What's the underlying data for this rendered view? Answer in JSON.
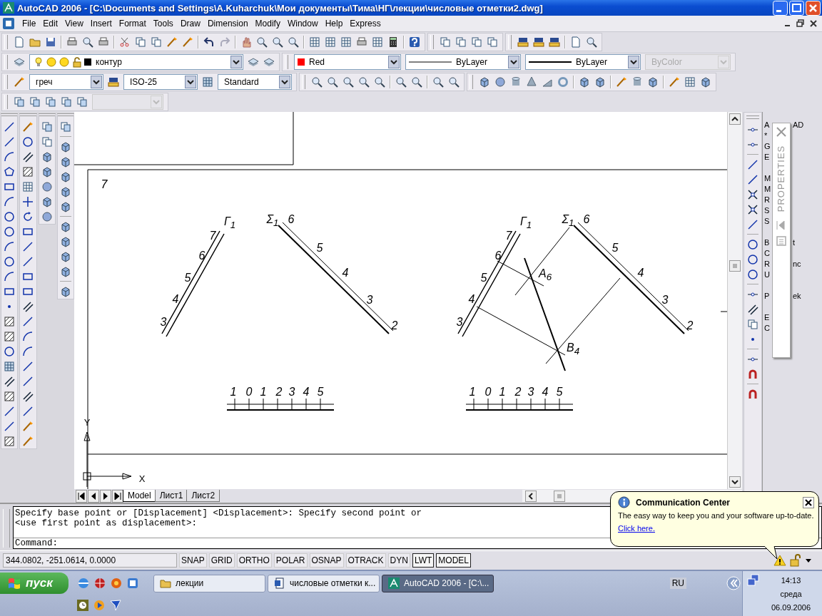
{
  "window": {
    "title": "AutoCAD 2006 - [C:\\Documents and Settings\\A.Kuharchuk\\Мои документы\\Тима\\НГ\\лекции\\числовые отметки2.dwg]"
  },
  "menu": [
    "File",
    "Edit",
    "View",
    "Insert",
    "Format",
    "Tools",
    "Draw",
    "Dimension",
    "Modify",
    "Window",
    "Help",
    "Express"
  ],
  "layer_bar": {
    "layer": {
      "name": "контур"
    },
    "color": {
      "label": "Red"
    },
    "linetype": "ByLayer",
    "lineweight": "ByLayer",
    "plot_style": {
      "value": "ByColor",
      "disabled": true
    }
  },
  "style_bar": {
    "text_style": "греч",
    "dim_style": "ISO-25",
    "table_style": "Standard"
  },
  "view_bar": {
    "dropdown": {
      "disabled": true
    }
  },
  "drawing": {
    "sheet_number": "7",
    "axis_labels": {
      "y": "Y",
      "x": "X"
    },
    "views": [
      {
        "trace_label": "Г$_{1}$",
        "trace_marks": [
          "3",
          "4",
          "5",
          "6",
          "7"
        ],
        "plane_label": "Σ$_{1}$",
        "plane_marks": [
          "6",
          "5",
          "4",
          "3",
          "2"
        ],
        "scale_labels": [
          "1",
          "0",
          "1",
          "2",
          "3",
          "4",
          "5"
        ]
      },
      {
        "trace_label": "Г$_{1}$",
        "trace_marks": [
          "3",
          "4",
          "5",
          "6",
          "7"
        ],
        "plane_label": "Σ$_{1}$",
        "plane_marks": [
          "6",
          "5",
          "4",
          "3",
          "2"
        ],
        "scale_labels": [
          "1",
          "0",
          "1",
          "2",
          "3",
          "4",
          "5"
        ],
        "points": [
          "A$_{6}$",
          "B$_{4}$"
        ]
      }
    ]
  },
  "layout_tabs": [
    {
      "label": "Model",
      "selected": true
    },
    {
      "label": "Лист1",
      "selected": false
    },
    {
      "label": "Лист2",
      "selected": false
    }
  ],
  "side_panel": {
    "groups": [
      [
        {
          "left": "A",
          "right": "AD"
        },
        {
          "left": "*"
        },
        {
          "left": "G"
        },
        {
          "left": "E"
        }
      ],
      [
        {
          "left": "M"
        },
        {
          "left": "M"
        },
        {
          "left": "R"
        },
        {
          "left": "S"
        },
        {
          "left": "S"
        }
      ],
      [
        {
          "left": "B",
          "right": "t"
        },
        {
          "left": "C"
        },
        {
          "left": "R",
          "right": "nc"
        },
        {
          "left": "U"
        }
      ],
      [
        {
          "left": "P",
          "right": "ek"
        }
      ],
      [
        {
          "left": "E"
        },
        {
          "left": "C"
        }
      ]
    ],
    "palette": {
      "title": "PROPERTIES"
    }
  },
  "command_line": {
    "history": [
      "Specify base point or [Displacement] <Displacement>: Specify second point or",
      "<use first point as displacement>:"
    ],
    "prompt": "Command:"
  },
  "status_bar": {
    "coordinates": "344.0802, -251.0614, 0.0000",
    "toggles": [
      {
        "label": "SNAP",
        "on": false
      },
      {
        "label": "GRID",
        "on": false
      },
      {
        "label": "ORTHO",
        "on": false
      },
      {
        "label": "POLAR",
        "on": false
      },
      {
        "label": "OSNAP",
        "on": false
      },
      {
        "label": "OTRACK",
        "on": false
      },
      {
        "label": "DYN",
        "on": false
      },
      {
        "label": "LWT",
        "on": true
      },
      {
        "label": "MODEL",
        "on": true
      }
    ]
  },
  "notification": {
    "title": "Communication Center",
    "message": "The easy way to keep you and your software up-to-date.",
    "link": "Click here."
  },
  "taskbar": {
    "start": "пуск",
    "tasks": [
      {
        "label": "лекции",
        "kind": "folder",
        "selected": false
      },
      {
        "label": "числовые отметки к...",
        "kind": "document",
        "selected": false
      },
      {
        "label": "AutoCAD 2006 - [C:\\...",
        "kind": "app",
        "selected": true
      }
    ],
    "language": "RU",
    "clock": {
      "time": "14:13",
      "day": "среда",
      "date": "06.09.2006"
    }
  }
}
